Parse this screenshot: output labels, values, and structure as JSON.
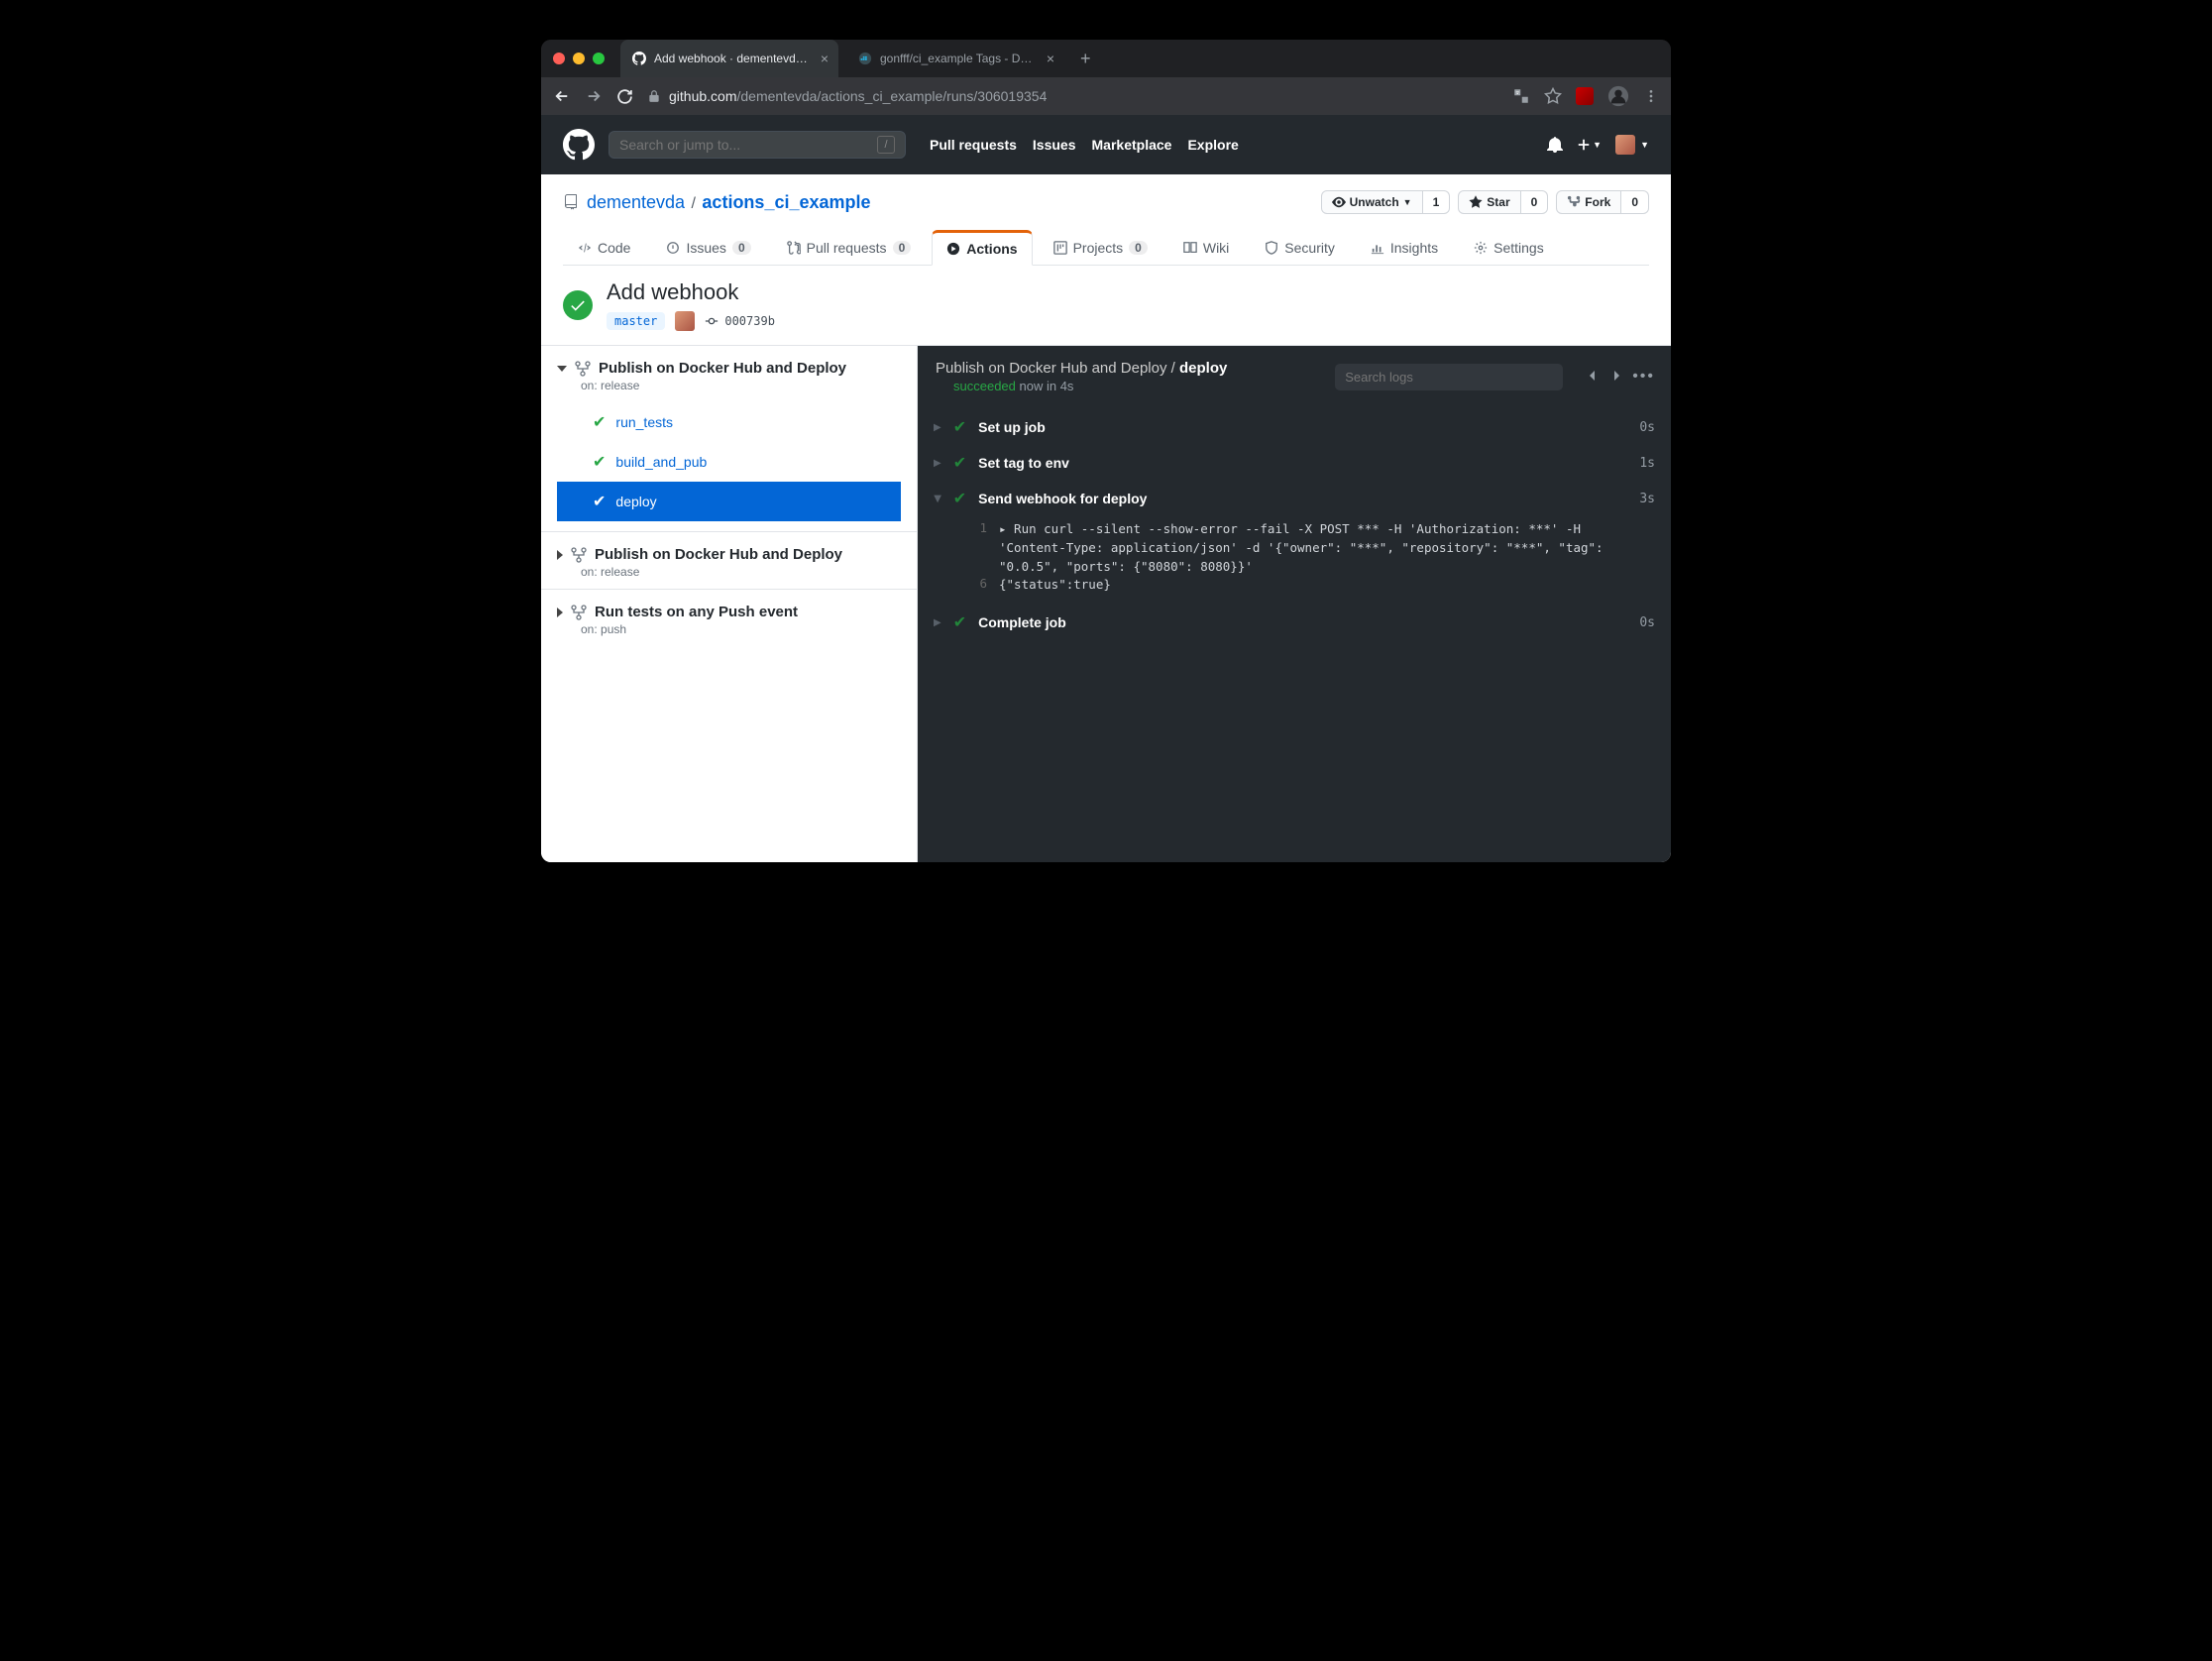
{
  "browser": {
    "tabs": [
      {
        "title": "Add webhook · dementevda/acti",
        "active": true,
        "favicon": "github"
      },
      {
        "title": "gonfff/ci_example Tags - Docker",
        "active": false,
        "favicon": "docker"
      }
    ],
    "url": {
      "host": "github.com",
      "path": "/dementevda/actions_ci_example/runs/306019354"
    }
  },
  "gh_header": {
    "search_placeholder": "Search or jump to...",
    "nav": [
      "Pull requests",
      "Issues",
      "Marketplace",
      "Explore"
    ]
  },
  "repo": {
    "owner": "dementevda",
    "name": "actions_ci_example",
    "actions": {
      "watch": {
        "label": "Unwatch",
        "count": "1"
      },
      "star": {
        "label": "Star",
        "count": "0"
      },
      "fork": {
        "label": "Fork",
        "count": "0"
      }
    },
    "tabs": {
      "code": "Code",
      "issues": {
        "label": "Issues",
        "count": "0"
      },
      "pulls": {
        "label": "Pull requests",
        "count": "0"
      },
      "actions": "Actions",
      "projects": {
        "label": "Projects",
        "count": "0"
      },
      "wiki": "Wiki",
      "security": "Security",
      "insights": "Insights",
      "settings": "Settings"
    }
  },
  "workflow": {
    "title": "Add webhook",
    "branch": "master",
    "commit": "000739b"
  },
  "sidebar": {
    "groups": [
      {
        "title": "Publish on Docker Hub and Deploy",
        "on": "on: release",
        "expanded": true,
        "jobs": [
          {
            "name": "run_tests",
            "active": false
          },
          {
            "name": "build_and_pub",
            "active": false
          },
          {
            "name": "deploy",
            "active": true
          }
        ]
      },
      {
        "title": "Publish on Docker Hub and Deploy",
        "on": "on: release",
        "expanded": false
      },
      {
        "title": "Run tests on any Push event",
        "on": "on: push",
        "expanded": false
      }
    ]
  },
  "logs": {
    "breadcrumb": {
      "workflow": "Publish on Docker Hub and Deploy",
      "job": "deploy"
    },
    "status": {
      "text": "succeeded",
      "time": "now in 4s"
    },
    "search_placeholder": "Search logs",
    "steps": [
      {
        "label": "Set up job",
        "time": "0s",
        "expanded": false
      },
      {
        "label": "Set tag to env",
        "time": "1s",
        "expanded": false
      },
      {
        "label": "Send webhook for deploy",
        "time": "3s",
        "expanded": true,
        "lines": [
          {
            "n": "1",
            "txt": "▸ Run curl --silent --show-error --fail -X POST *** -H 'Authorization: ***' -H 'Content-Type: application/json' -d '{\"owner\": \"***\", \"repository\": \"***\", \"tag\": \"0.0.5\", \"ports\": {\"8080\": 8080}}'"
          },
          {
            "n": "6",
            "txt": "{\"status\":true}"
          }
        ]
      },
      {
        "label": "Complete job",
        "time": "0s",
        "expanded": false
      }
    ]
  }
}
